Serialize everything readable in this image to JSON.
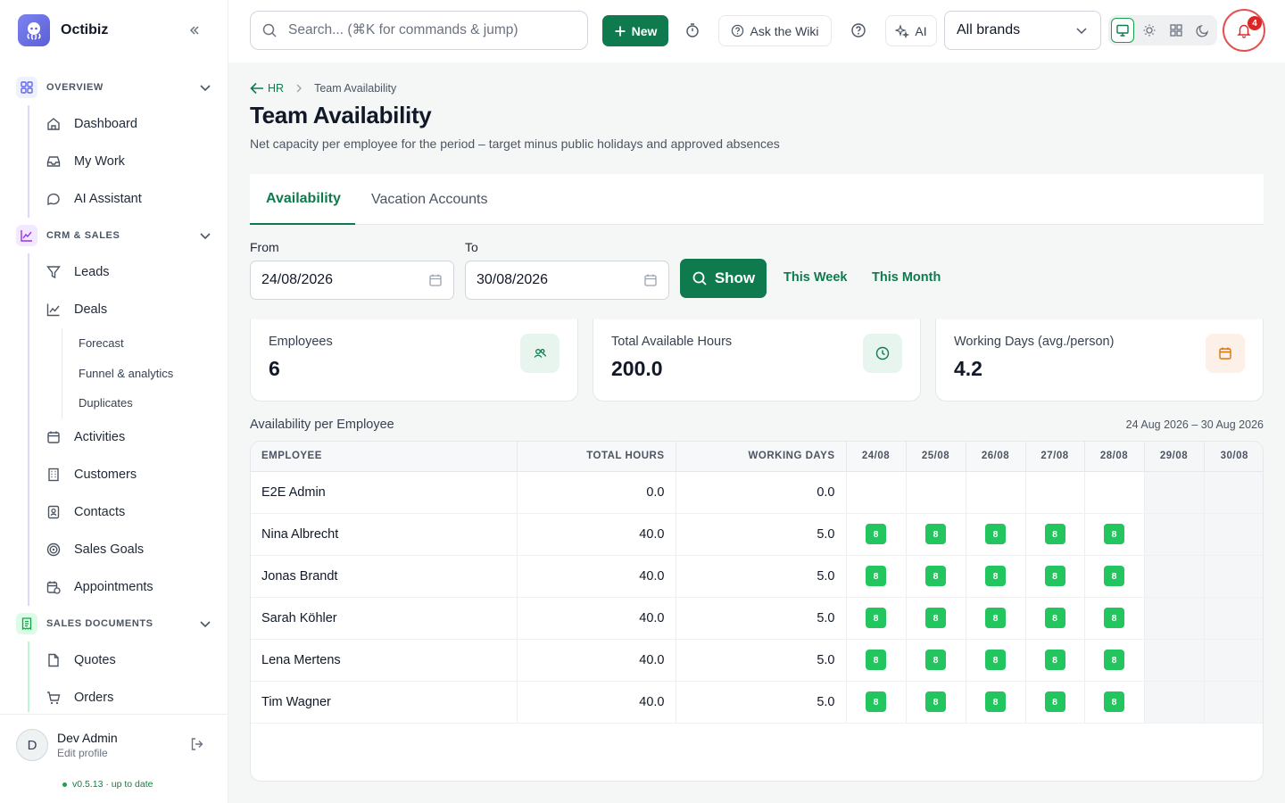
{
  "app": {
    "name": "Octibiz"
  },
  "sidebar": {
    "sections": [
      {
        "label": "OVERVIEW",
        "items": [
          "Dashboard",
          "My Work",
          "AI Assistant"
        ]
      },
      {
        "label": "CRM & SALES",
        "items": [
          "Leads",
          "Deals",
          "Activities",
          "Customers",
          "Contacts",
          "Sales Goals",
          "Appointments"
        ],
        "deals_sub": [
          "Forecast",
          "Funnel & analytics",
          "Duplicates"
        ]
      },
      {
        "label": "SALES DOCUMENTS",
        "items": [
          "Quotes",
          "Orders"
        ]
      }
    ],
    "user": {
      "initial": "D",
      "name": "Dev Admin",
      "sub": "Edit profile"
    },
    "version": "v0.5.13 · up to date"
  },
  "topbar": {
    "search_placeholder": "Search... (⌘K for commands & jump)",
    "new_label": "New",
    "wiki_label": "Ask the Wiki",
    "ai_label": "AI",
    "brand_select": "All brands",
    "notifications": "4"
  },
  "page": {
    "breadcrumb_parent": "HR",
    "breadcrumb_current": "Team Availability",
    "title": "Team Availability",
    "subtitle": "Net capacity per employee for the period – target minus public holidays and approved absences",
    "tabs": [
      "Availability",
      "Vacation Accounts"
    ],
    "filters": {
      "from_label": "From",
      "from_value": "24/08/2026",
      "to_label": "To",
      "to_value": "30/08/2026",
      "show_label": "Show",
      "this_week": "This Week",
      "this_month": "This Month"
    },
    "cards": [
      {
        "label": "Employees",
        "value": "6"
      },
      {
        "label": "Total Available Hours",
        "value": "200.0"
      },
      {
        "label": "Working Days (avg./person)",
        "value": "4.2"
      }
    ],
    "table_caption": "Availability per Employee",
    "table_range": "24 Aug 2026 – 30 Aug 2026",
    "columns": [
      "EMPLOYEE",
      "TOTAL HOURS",
      "WORKING DAYS",
      "24/08",
      "25/08",
      "26/08",
      "27/08",
      "28/08",
      "29/08",
      "30/08"
    ],
    "rows": [
      {
        "name": "E2E Admin",
        "hours": "0.0",
        "days": "0.0",
        "cells": [
          "",
          "",
          "",
          "",
          "",
          "",
          ""
        ]
      },
      {
        "name": "Nina Albrecht",
        "hours": "40.0",
        "days": "5.0",
        "cells": [
          "8",
          "8",
          "8",
          "8",
          "8",
          "",
          ""
        ]
      },
      {
        "name": "Jonas Brandt",
        "hours": "40.0",
        "days": "5.0",
        "cells": [
          "8",
          "8",
          "8",
          "8",
          "8",
          "",
          ""
        ]
      },
      {
        "name": "Sarah Köhler",
        "hours": "40.0",
        "days": "5.0",
        "cells": [
          "8",
          "8",
          "8",
          "8",
          "8",
          "",
          ""
        ]
      },
      {
        "name": "Lena Mertens",
        "hours": "40.0",
        "days": "5.0",
        "cells": [
          "8",
          "8",
          "8",
          "8",
          "8",
          "",
          ""
        ]
      },
      {
        "name": "Tim Wagner",
        "hours": "40.0",
        "days": "5.0",
        "cells": [
          "8",
          "8",
          "8",
          "8",
          "8",
          "",
          ""
        ]
      }
    ]
  },
  "colors": {
    "accent": "#0f7a4d",
    "badge": "#22c55e",
    "alert": "#dc2626"
  }
}
